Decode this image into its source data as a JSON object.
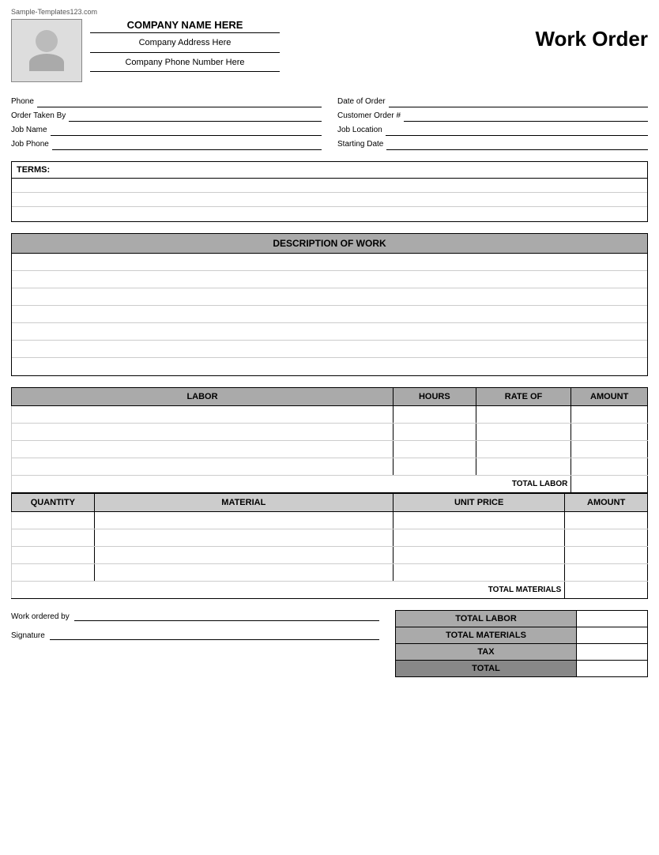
{
  "watermark": "Sample-Templates123.com",
  "header": {
    "company_name": "COMPANY NAME HERE",
    "company_address": "Company Address Here",
    "company_phone": "Company Phone Number Here",
    "title": "Work Order"
  },
  "form": {
    "left": [
      {
        "label": "Phone",
        "id": "phone"
      },
      {
        "label": "Order Taken By",
        "id": "order-taken-by"
      },
      {
        "label": "Job Name",
        "id": "job-name"
      },
      {
        "label": "Job Phone",
        "id": "job-phone"
      }
    ],
    "right": [
      {
        "label": "Date of Order",
        "id": "date-of-order"
      },
      {
        "label": "Customer Order #",
        "id": "customer-order"
      },
      {
        "label": "Job Location",
        "id": "job-location"
      },
      {
        "label": "Starting Date",
        "id": "starting-date"
      }
    ]
  },
  "terms": {
    "header": "TERMS:",
    "rows": 3
  },
  "description": {
    "header": "DESCRIPTION OF WORK",
    "rows": 7
  },
  "labor": {
    "columns": [
      "LABOR",
      "HOURS",
      "RATE OF",
      "AMOUNT"
    ],
    "rows": 4,
    "total_label": "TOTAL LABOR"
  },
  "materials": {
    "columns": [
      "QUANTITY",
      "MATERIAL",
      "UNIT PRICE",
      "AMOUNT"
    ],
    "rows": 4,
    "total_label": "TOTAL MATERIALS"
  },
  "summary": {
    "rows": [
      "TOTAL LABOR",
      "TOTAL MATERIALS",
      "TAX",
      "TOTAL"
    ]
  },
  "signature": {
    "work_ordered_by_label": "Work ordered by",
    "signature_label": "Signature"
  }
}
